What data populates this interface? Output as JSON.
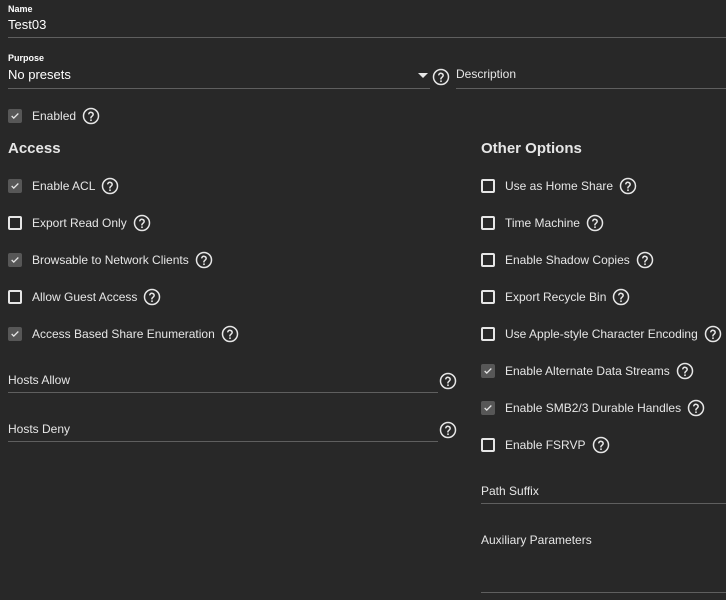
{
  "name": {
    "label": "Name",
    "value": "Test03"
  },
  "purpose": {
    "label": "Purpose",
    "value": "No presets"
  },
  "description": {
    "placeholder": "Description"
  },
  "enabled": {
    "label": "Enabled",
    "checked": true
  },
  "access": {
    "title": "Access",
    "options": [
      {
        "label": "Enable ACL",
        "checked": true
      },
      {
        "label": "Export Read Only",
        "checked": false
      },
      {
        "label": "Browsable to Network Clients",
        "checked": true
      },
      {
        "label": "Allow Guest Access",
        "checked": false
      },
      {
        "label": "Access Based Share Enumeration",
        "checked": true
      }
    ],
    "hosts_allow": "Hosts Allow",
    "hosts_deny": "Hosts Deny"
  },
  "other": {
    "title": "Other Options",
    "options": [
      {
        "label": "Use as Home Share",
        "checked": false
      },
      {
        "label": "Time Machine",
        "checked": false
      },
      {
        "label": "Enable Shadow Copies",
        "checked": false
      },
      {
        "label": "Export Recycle Bin",
        "checked": false
      },
      {
        "label": "Use Apple-style Character Encoding",
        "checked": false
      },
      {
        "label": "Enable Alternate Data Streams",
        "checked": true
      },
      {
        "label": "Enable SMB2/3 Durable Handles",
        "checked": true
      },
      {
        "label": "Enable FSRVP",
        "checked": false
      }
    ],
    "path_suffix": "Path Suffix",
    "aux_params": "Auxiliary Parameters"
  },
  "colors": {
    "background": "#282828",
    "text": "#e6e6e6",
    "line": "#5f5f5f",
    "checked_fill": "#575757"
  },
  "icons": {
    "help": "help-circle-icon",
    "check": "check-icon",
    "dropdown": "caret-down-icon"
  }
}
